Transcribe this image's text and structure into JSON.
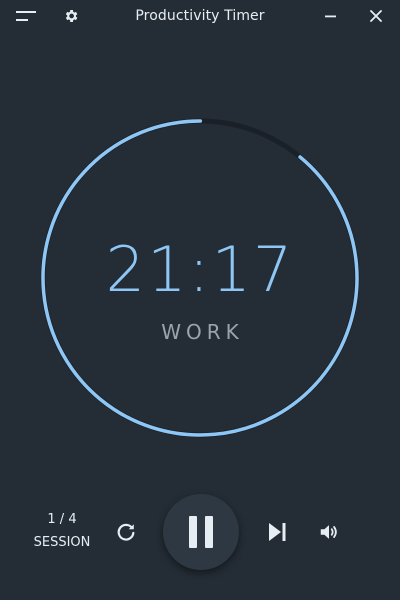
{
  "window": {
    "title": "Productivity Timer"
  },
  "titlebar": {
    "menu_icon": "hamburger-menu-icon",
    "settings_icon": "gear-icon",
    "minimize_icon": "minimize-icon",
    "close_icon": "close-icon"
  },
  "timer": {
    "time": "21:17",
    "mode": "WORK",
    "progress_remaining": 0.89,
    "colors": {
      "progress": "#8ec7f5",
      "track": "#1a2027",
      "background": "#242c35"
    }
  },
  "session": {
    "count": "1 / 4",
    "label": "SESSION"
  },
  "controls": {
    "restart_icon": "restart-icon",
    "play_pause_icon": "pause-icon",
    "skip_icon": "skip-next-icon",
    "volume_icon": "volume-icon"
  }
}
